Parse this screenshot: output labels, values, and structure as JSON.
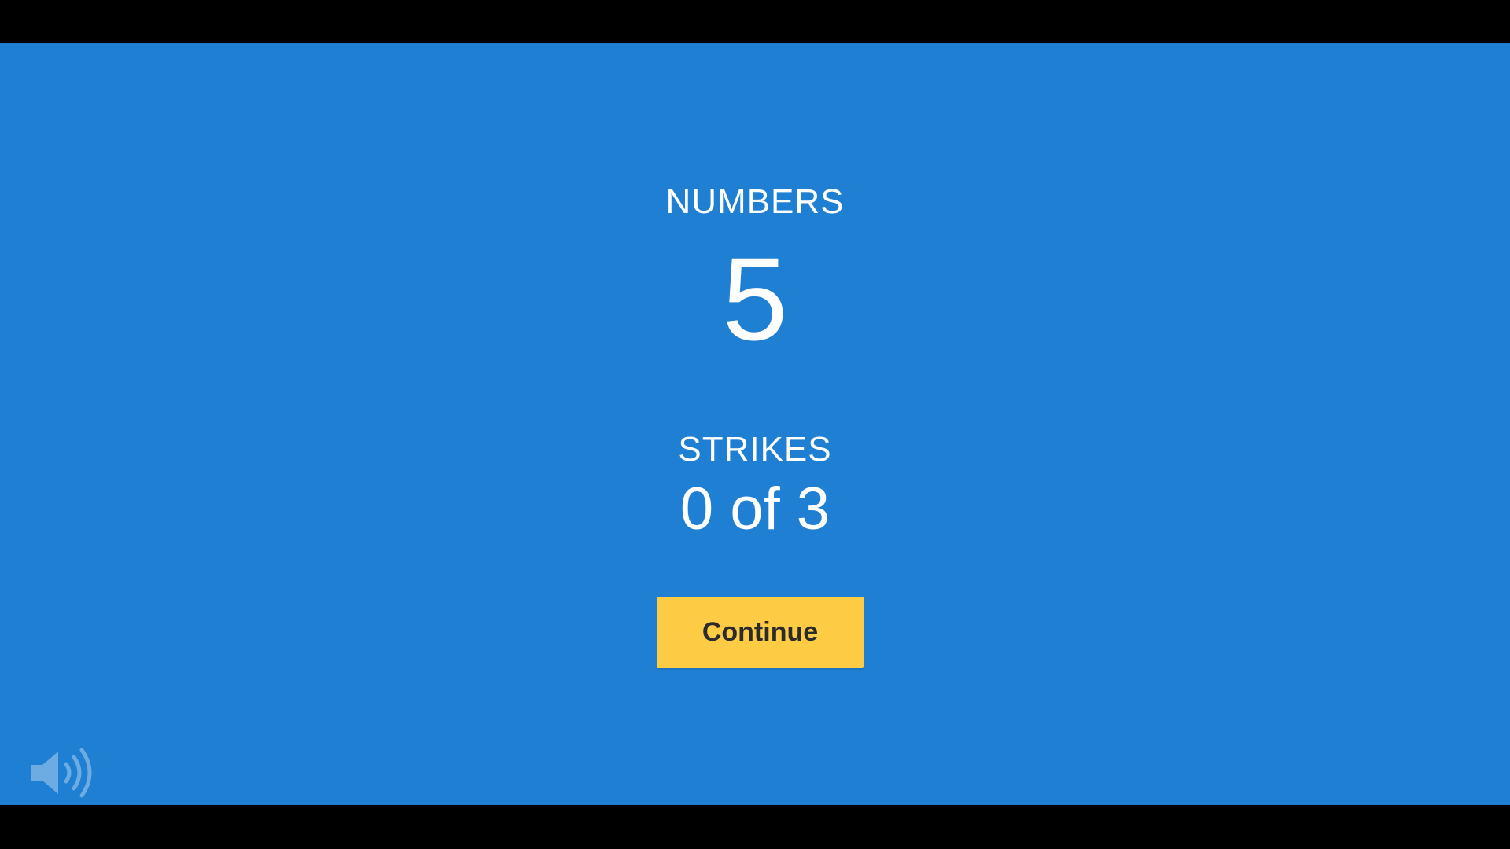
{
  "game": {
    "numbers_label": "NUMBERS",
    "numbers_value": "5",
    "strikes_label": "STRIKES",
    "strikes_value": "0 of 3",
    "continue_label": "Continue"
  },
  "icons": {
    "sound": "speaker-volume-icon"
  },
  "colors": {
    "background": "#1f7fd3",
    "button": "#fecb45",
    "button_text": "#2b2b2b",
    "text": "#ffffff",
    "letterbox": "#000000"
  }
}
